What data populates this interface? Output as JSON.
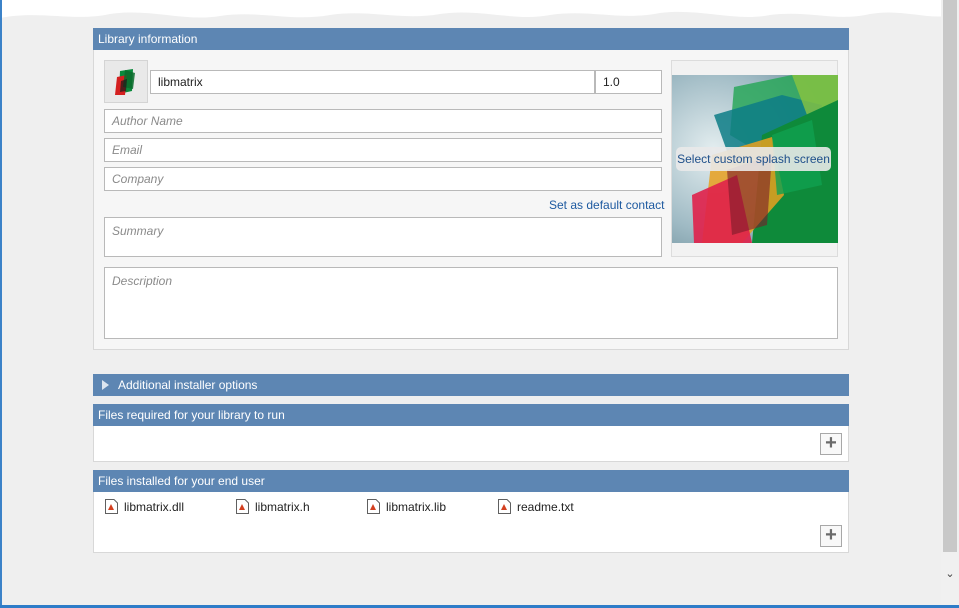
{
  "library_info": {
    "header": "Library information",
    "name_value": "libmatrix",
    "version_value": "1.0",
    "author_placeholder": "Author Name",
    "email_placeholder": "Email",
    "company_placeholder": "Company",
    "set_default_contact": "Set as default contact",
    "summary_placeholder": "Summary",
    "description_placeholder": "Description",
    "splash_button": "Select custom splash screen",
    "app_icon": "matlab-app-icon"
  },
  "additional_options": {
    "label": "Additional installer options",
    "expand_icon": "triangle-right-icon"
  },
  "files_required": {
    "header": "Files required for your library to run",
    "add_icon": "plus-icon"
  },
  "files_installed": {
    "header": "Files installed for your end user",
    "add_icon": "plus-icon",
    "files": [
      "libmatrix.dll",
      "libmatrix.h",
      "libmatrix.lib",
      "readme.txt"
    ]
  },
  "scrollbar": {
    "down_icon": "chevron-down-icon"
  },
  "colors": {
    "section_header": "#5d86b3",
    "link": "#1e5aa0",
    "background": "#efefef"
  }
}
